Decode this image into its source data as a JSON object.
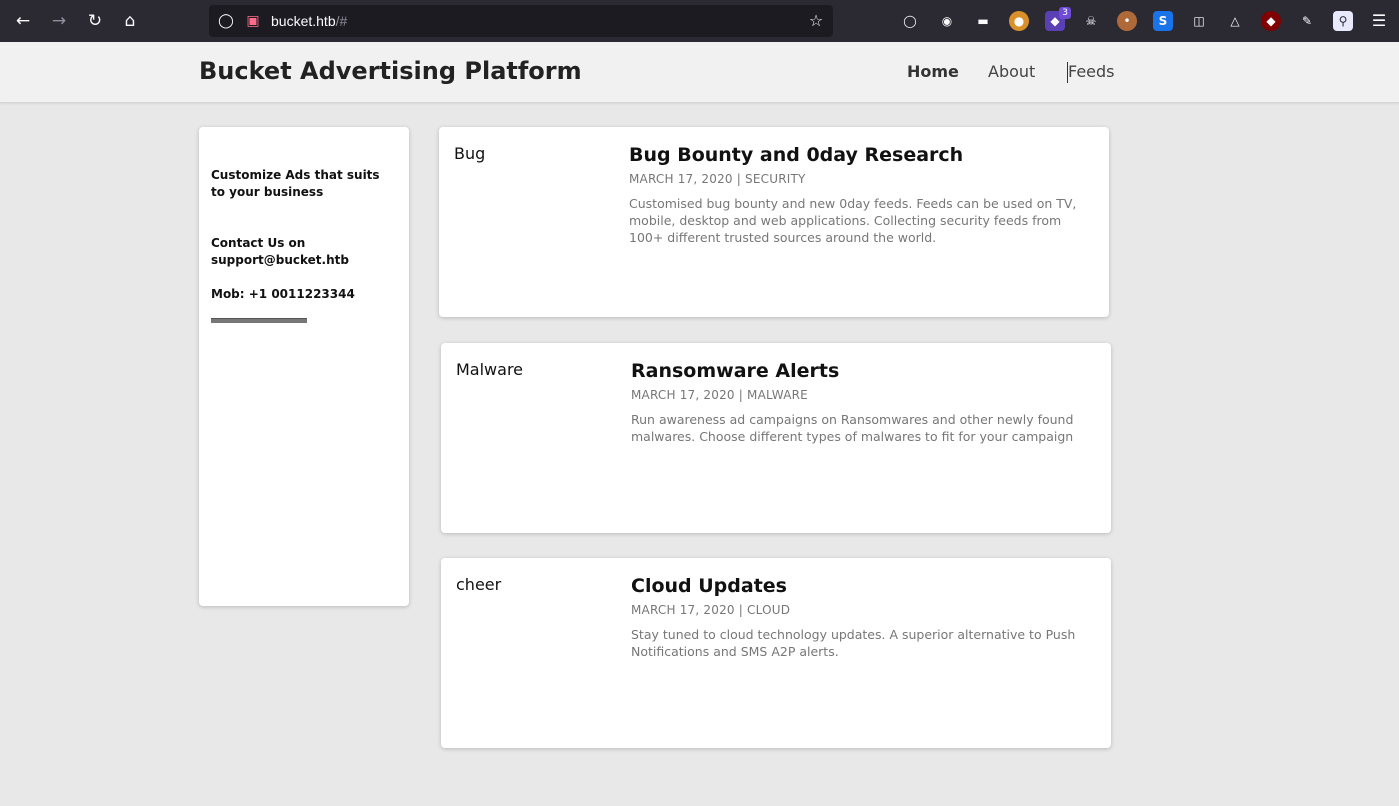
{
  "browser": {
    "back_icon": "arrow-left-icon",
    "forward_icon": "arrow-right-icon",
    "reload_icon": "reload-icon",
    "home_icon": "home-icon",
    "url_host": "bucket.htb",
    "url_path": "/#",
    "extension_badge": "3"
  },
  "header": {
    "site_title": "Bucket Advertising Platform",
    "nav": {
      "home": "Home",
      "about": "About",
      "feeds": "Feeds"
    }
  },
  "sidebar": {
    "tagline": "Customize Ads that suits to your business",
    "contact_label": "Contact Us on",
    "contact_email": "support@bucket.htb",
    "phone": "Mob: +1 0011223344"
  },
  "posts": [
    {
      "tag": "Bug",
      "title": "Bug Bounty and 0day Research",
      "date": "MARCH 17, 2020",
      "category": "SECURITY",
      "description": "Customised bug bounty and new 0day feeds. Feeds can be used on TV, mobile, desktop and web applications. Collecting security feeds from 100+ different trusted sources around the world."
    },
    {
      "tag": "Malware",
      "title": "Ransomware Alerts",
      "date": "MARCH 17, 2020",
      "category": "MALWARE",
      "description": "Run awareness ad campaigns on Ransomwares and other newly found malwares. Choose different types of malwares to fit for your campaign"
    },
    {
      "tag": "cheer",
      "title": "Cloud Updates",
      "date": "MARCH 17, 2020",
      "category": "CLOUD",
      "description": "Stay tuned to cloud technology updates. A superior alternative to Push Notifications and SMS A2P alerts."
    }
  ],
  "meta_separator": "|"
}
